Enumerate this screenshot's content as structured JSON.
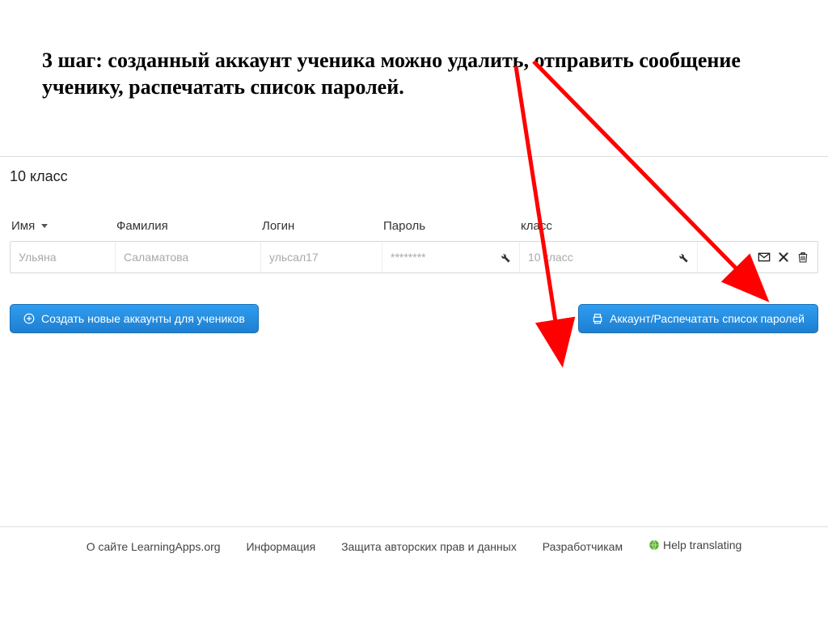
{
  "instruction": "3 шаг: созданный аккаунт ученика можно удалить, отправить сообщение ученику, распечатать список паролей.",
  "class_title": "10 класс",
  "headers": {
    "name": "Имя",
    "surname": "Фамилия",
    "login": "Логин",
    "password": "Пароль",
    "class": "класс"
  },
  "row": {
    "name": "Ульяна",
    "surname": "Саламатова",
    "login": "ульсал17",
    "password": "********",
    "class": "10 класс"
  },
  "buttons": {
    "create": "Создать новые аккаунты для учеников",
    "print": "Аккаунт/Распечатать список паролей"
  },
  "footer": {
    "about": "О сайте LearningApps.org",
    "info": "Информация",
    "copyright": "Защита авторских прав и данных",
    "developers": "Разработчикам",
    "help": "Help translating"
  }
}
